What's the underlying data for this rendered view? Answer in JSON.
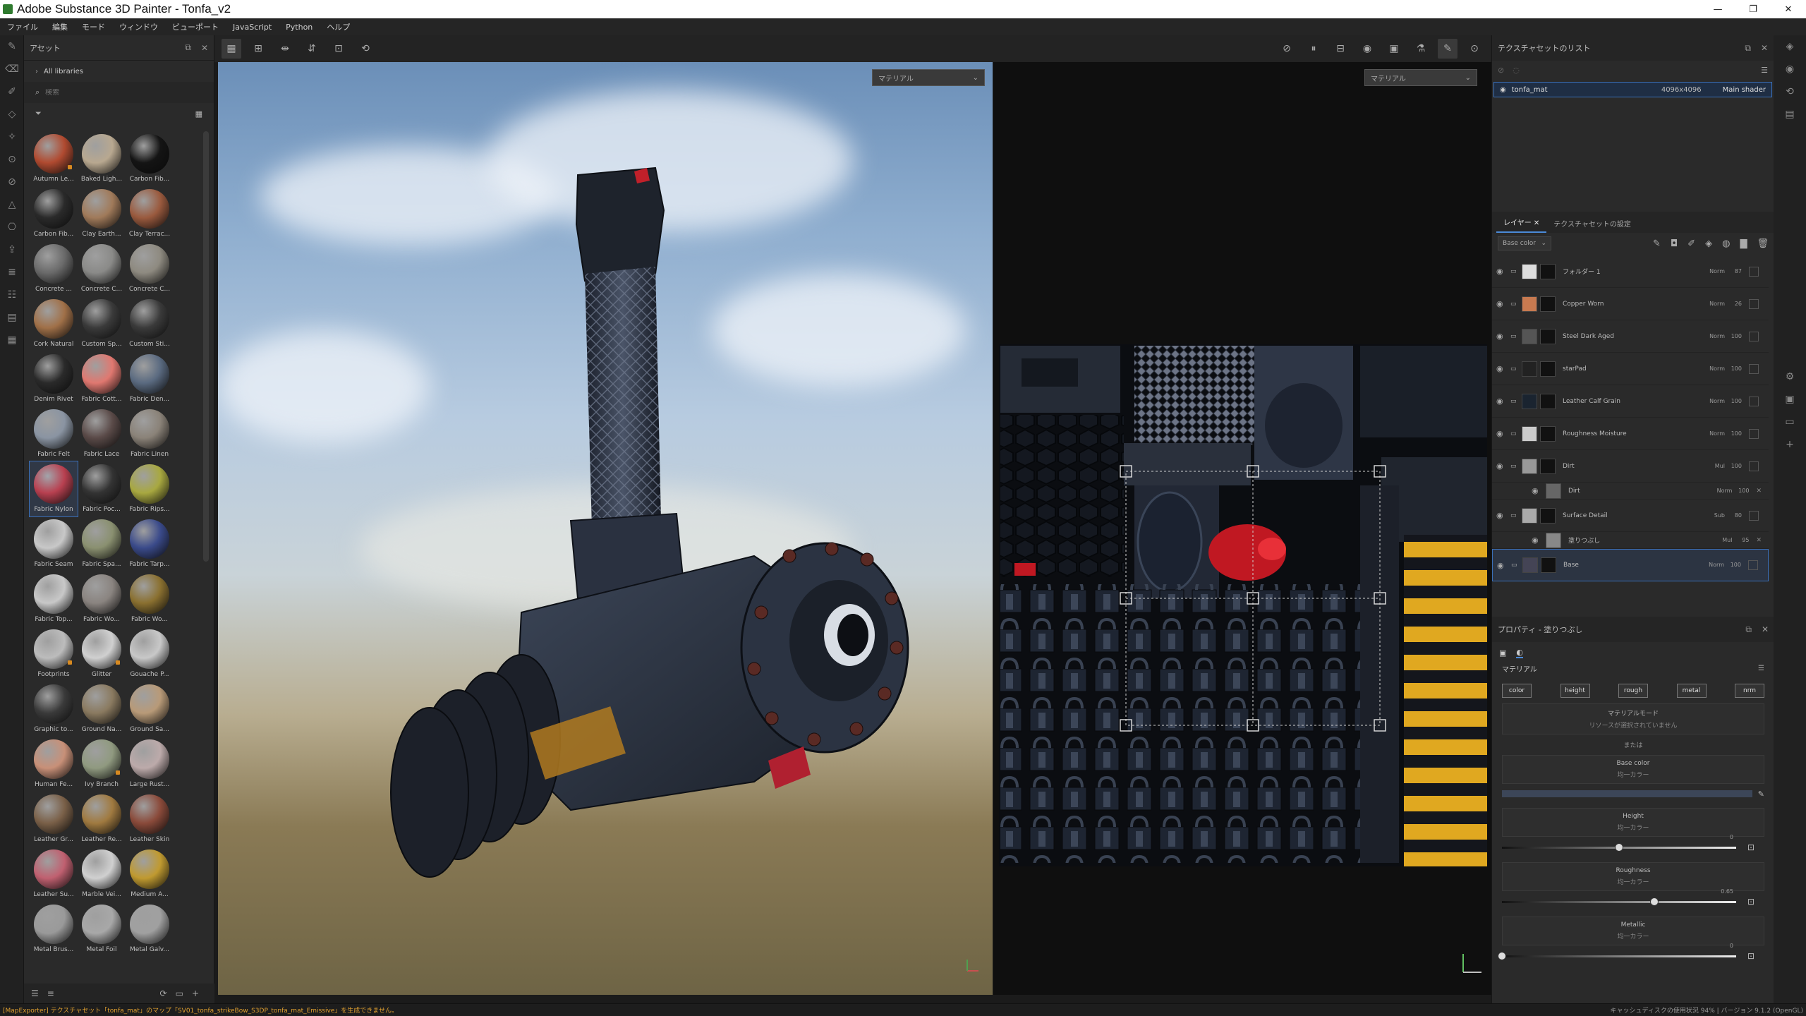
{
  "window": {
    "title": "Adobe Substance 3D Painter - Tonfa_v2",
    "controls": [
      "—",
      "❐",
      "✕"
    ]
  },
  "menu": [
    "ファイル",
    "編集",
    "モード",
    "ウィンドウ",
    "ビューポート",
    "JavaScript",
    "Python",
    "ヘルプ"
  ],
  "assets": {
    "title": "アセット",
    "library": "All libraries",
    "search_placeholder": "検索",
    "items": [
      {
        "label": "Autumn Le...",
        "color": "#b04a30",
        "dot": true
      },
      {
        "label": "Baked Ligh...",
        "color": "#b8a890"
      },
      {
        "label": "Carbon Fib...",
        "color": "#141414"
      },
      {
        "label": "Carbon Fib...",
        "color": "#2a2a2a"
      },
      {
        "label": "Clay Earth...",
        "color": "#a07a5a"
      },
      {
        "label": "Clay Terrac...",
        "color": "#9a5a3e"
      },
      {
        "label": "Concrete ...",
        "color": "#6a6a6a"
      },
      {
        "label": "Concrete C...",
        "color": "#8a8a88"
      },
      {
        "label": "Concrete C...",
        "color": "#8e8a80"
      },
      {
        "label": "Cork Natural",
        "color": "#a07048"
      },
      {
        "label": "Custom Sp...",
        "color": "#3a3a3a"
      },
      {
        "label": "Custom Sti...",
        "color": "#3a3a3a"
      },
      {
        "label": "Denim Rivet",
        "color": "#2a2a2a"
      },
      {
        "label": "Fabric Cott...",
        "color": "#e07870"
      },
      {
        "label": "Fabric Den...",
        "color": "#5a6a80"
      },
      {
        "label": "Fabric Felt",
        "color": "#8a94a2"
      },
      {
        "label": "Fabric Lace",
        "color": "#5a4a48"
      },
      {
        "label": "Fabric Linen",
        "color": "#8a8278"
      },
      {
        "label": "Fabric Nylon",
        "color": "#b84050",
        "selected": true
      },
      {
        "label": "Fabric Poc...",
        "color": "#333333"
      },
      {
        "label": "Fabric Rips...",
        "color": "#a8a840"
      },
      {
        "label": "Fabric Seam",
        "color": "#c8c8c8"
      },
      {
        "label": "Fabric Spa...",
        "color": "#8a9070"
      },
      {
        "label": "Fabric Tarp...",
        "color": "#3a4a8a"
      },
      {
        "label": "Fabric Top...",
        "color": "#c8c8c8"
      },
      {
        "label": "Fabric Wo...",
        "color": "#8a8480"
      },
      {
        "label": "Fabric Wo...",
        "color": "#8a7030"
      },
      {
        "label": "Footprints",
        "color": "#bcbcbc",
        "dot": true
      },
      {
        "label": "Glitter",
        "color": "#d0d0d0",
        "dot": true
      },
      {
        "label": "Gouache P...",
        "color": "#c8c8c8"
      },
      {
        "label": "Graphic to...",
        "color": "#3a3a3a"
      },
      {
        "label": "Ground Na...",
        "color": "#8a7a60"
      },
      {
        "label": "Ground Sa...",
        "color": "#b89a78"
      },
      {
        "label": "Human Fe...",
        "color": "#c89078"
      },
      {
        "label": "Ivy Branch",
        "color": "#909a80",
        "dot": true
      },
      {
        "label": "Large Rust...",
        "color": "#bcaaaa"
      },
      {
        "label": "Leather Gr...",
        "color": "#7a6048"
      },
      {
        "label": "Leather Re...",
        "color": "#a07a40"
      },
      {
        "label": "Leather Skin",
        "color": "#8a4a3a"
      },
      {
        "label": "Leather Su...",
        "color": "#c06070"
      },
      {
        "label": "Marble Vei...",
        "color": "#d0d0d0"
      },
      {
        "label": "Medium A...",
        "color": "#c09a30"
      },
      {
        "label": "Metal Brus...",
        "color": "#9a9a9a"
      },
      {
        "label": "Metal Foil",
        "color": "#a8a8a8"
      },
      {
        "label": "Metal Galv...",
        "color": "#a0a0a0"
      }
    ]
  },
  "viewport": {
    "dropdown3d": "マテリアル",
    "dropdown2d": "マテリアル"
  },
  "texture_sets": {
    "title": "テクスチャセットのリスト",
    "row": {
      "name": "tonfa_mat",
      "resolution": "4096x4096",
      "shader": "Main shader"
    }
  },
  "layers": {
    "tab_layers": "レイヤー",
    "tab_settings": "テクスチャセットの設定",
    "channel": "Base color",
    "items": [
      {
        "name": "フォルダー 1",
        "blend": "Norm",
        "opacity": "87",
        "color": "#ddd"
      },
      {
        "name": "Copper Worn",
        "blend": "Norm",
        "opacity": "26",
        "color": "#c87a50"
      },
      {
        "name": "Steel Dark Aged",
        "blend": "Norm",
        "opacity": "100",
        "color": "#555"
      },
      {
        "name": "starPad",
        "blend": "Norm",
        "opacity": "100",
        "color": "#222"
      },
      {
        "name": "Leather Calf Grain",
        "blend": "Norm",
        "opacity": "100",
        "color": "#1a2430"
      },
      {
        "name": "Roughness Moisture",
        "blend": "Norm",
        "opacity": "100",
        "color": "#ccc"
      },
      {
        "name": "Dirt",
        "blend": "Mul",
        "opacity": "100",
        "color": "#999"
      },
      {
        "name": "Dirt",
        "blend": "Norm",
        "opacity": "100",
        "color": "#666",
        "sub": true
      },
      {
        "name": "Surface Detail",
        "blend": "Sub",
        "opacity": "80",
        "color": "#aaa"
      },
      {
        "name": "塗りつぶし",
        "blend": "Mul",
        "opacity": "95",
        "color": "#888",
        "sub": true
      },
      {
        "name": "Base",
        "blend": "Norm",
        "opacity": "100",
        "color": "#445",
        "selected": true
      }
    ]
  },
  "properties": {
    "title": "プロパティ - 塗りつぶし",
    "section": "マテリアル",
    "chips": [
      "color",
      "height",
      "rough",
      "metal",
      "nrm"
    ],
    "material_mode": "マテリアルモード",
    "no_resource": "リソースが選択されていません",
    "or": "または",
    "base_color": "Base color",
    "uniform_color": "均一カラー",
    "height": "Height",
    "height_value": "0",
    "height_pos": 0.5,
    "roughness": "Roughness",
    "roughness_value": "0.65",
    "roughness_pos": 0.65,
    "metallic": "Metallic",
    "metallic_value": "0",
    "metallic_pos": 0
  },
  "status": {
    "message": "[MapExporter] テクスチャセット「tonfa_mat」のマップ「SV01_tonfa_strikeBow_S3DP_tonfa_mat_Emissive」を生成できません。",
    "right": "キャッシュディスクの使用状況  94% | バージョン 9.1.2 (OpenGL)"
  }
}
